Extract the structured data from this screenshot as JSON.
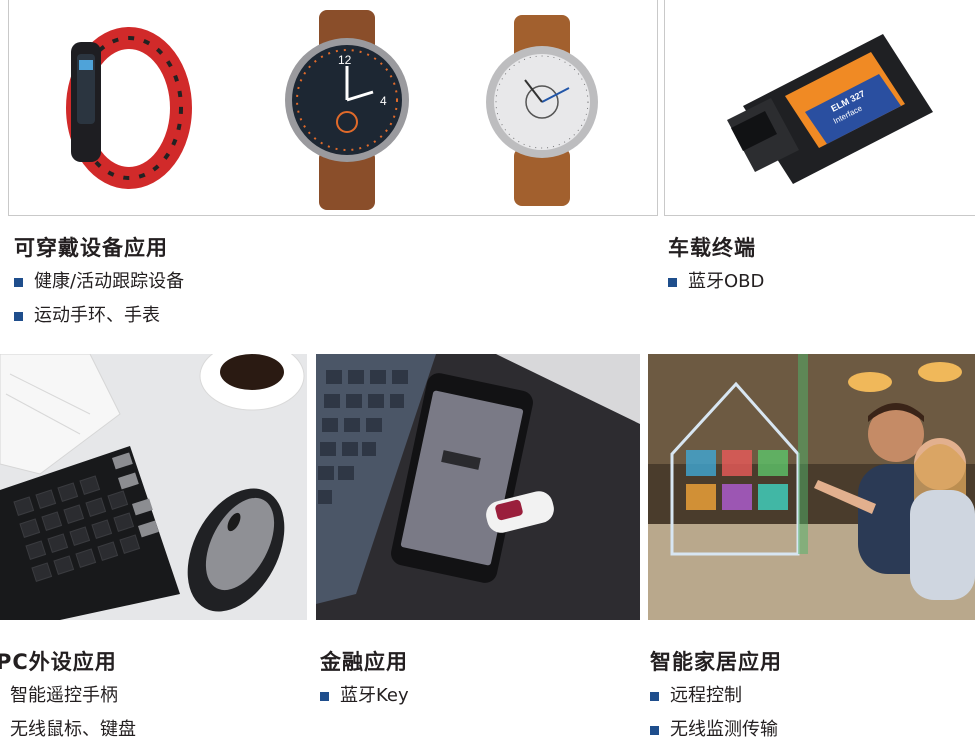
{
  "sections": {
    "wearable": {
      "title": "可穿戴设备应用",
      "items": [
        "健康/活动跟踪设备",
        "运动手环、手表"
      ]
    },
    "vehicle": {
      "title": "车载终端",
      "items": [
        "蓝牙OBD"
      ]
    },
    "pc": {
      "title": "PC外设应用",
      "items": [
        "智能遥控手柄",
        "无线鼠标、键盘"
      ]
    },
    "finance": {
      "title": "金融应用",
      "items": [
        "蓝牙Key"
      ]
    },
    "smarthome": {
      "title": "智能家居应用",
      "items": [
        "远程控制",
        "无线监测传输"
      ]
    }
  },
  "obd_device": {
    "label_line1": "ELM 327",
    "label_line2": "Interface"
  },
  "watch_face": {
    "numerals": [
      "12",
      "4"
    ]
  },
  "colors": {
    "bullet": "#1f4e8c",
    "title": "#231f20",
    "border": "#c9c9c9",
    "obd_label": "#f08a24"
  }
}
